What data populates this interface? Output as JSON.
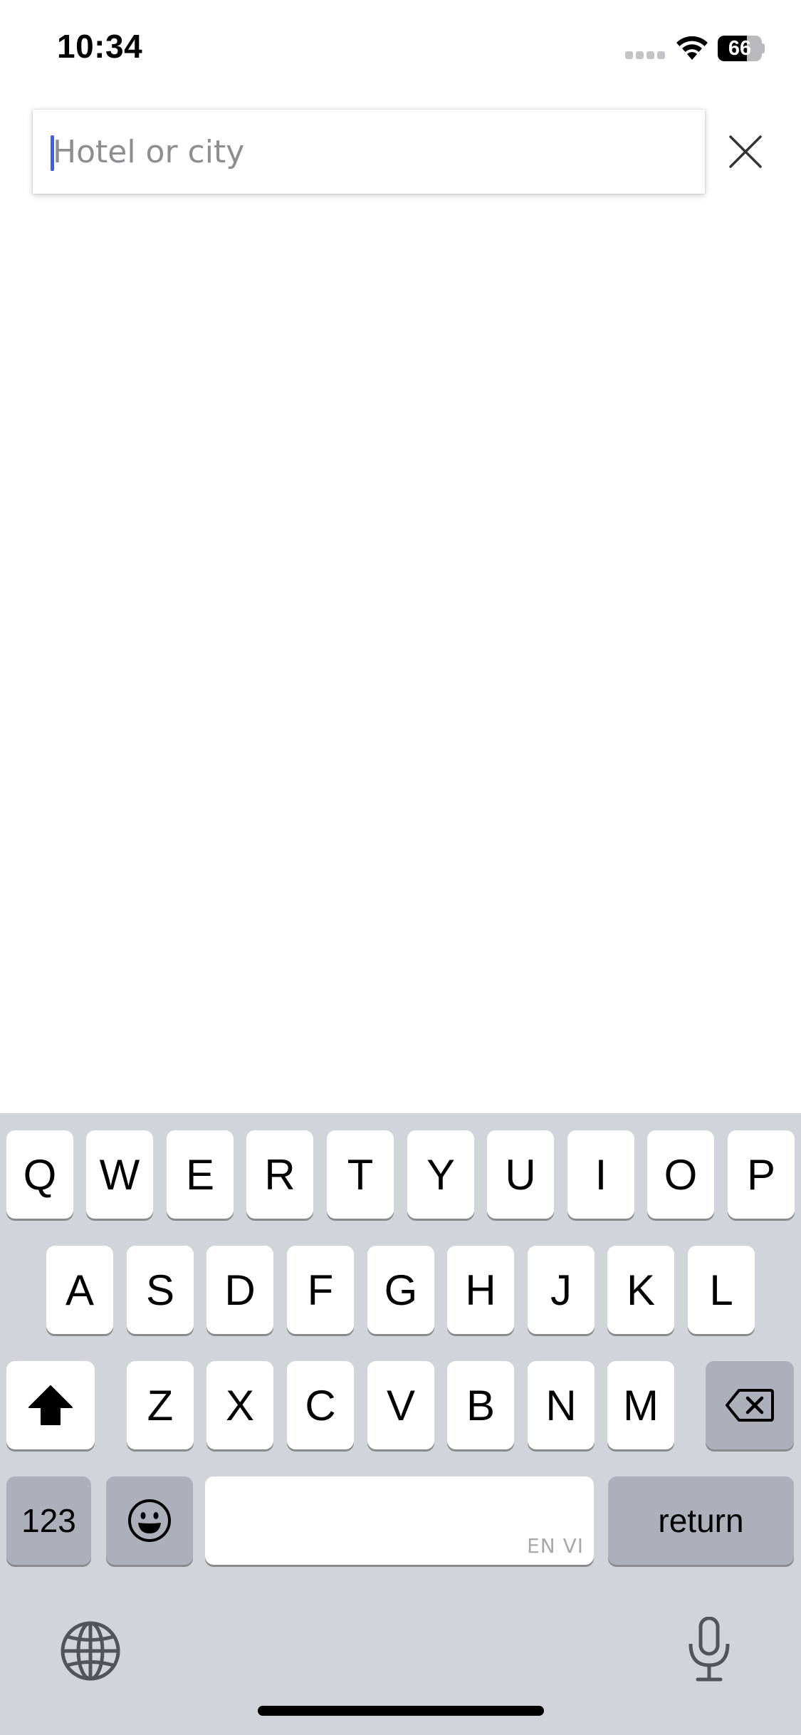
{
  "status_bar": {
    "time": "10:34",
    "battery_level": "66",
    "battery_fraction": 0.66,
    "icons": [
      "signal-icon",
      "wifi-icon",
      "battery-icon"
    ]
  },
  "search": {
    "placeholder": "Hotel or city",
    "value": "",
    "caret_color": "#3d5cf0",
    "close_icon": "close-icon"
  },
  "keyboard": {
    "row1": [
      "Q",
      "W",
      "E",
      "R",
      "T",
      "Y",
      "U",
      "I",
      "O",
      "P"
    ],
    "row2": [
      "A",
      "S",
      "D",
      "F",
      "G",
      "H",
      "J",
      "K",
      "L"
    ],
    "row3": [
      "Z",
      "X",
      "C",
      "V",
      "B",
      "N",
      "M"
    ],
    "shift_icon": "shift-icon",
    "delete_icon": "delete-icon",
    "numbers_label": "123",
    "emoji_icon": "emoji-icon",
    "space_language": "EN VI",
    "return_label": "return",
    "globe_icon": "globe-icon",
    "mic_icon": "microphone-icon"
  },
  "colors": {
    "keyboard_bg": "#d1d4db",
    "key_bg": "#ffffff",
    "function_key_bg": "#abb0bb"
  }
}
